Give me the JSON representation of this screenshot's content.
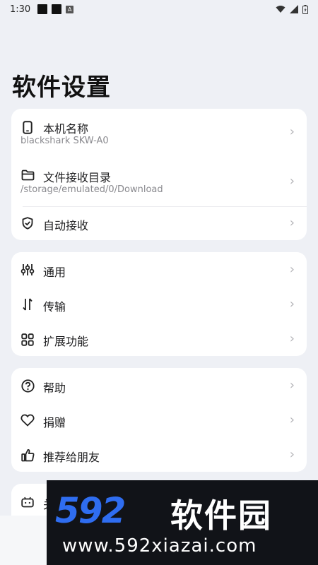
{
  "status": {
    "time": "1:30",
    "badge": "A"
  },
  "title": "软件设置",
  "card1": {
    "device": {
      "label": "本机名称",
      "value": "blackshark SKW-A0",
      "icon": "phone-icon"
    },
    "folder": {
      "label": "文件接收目录",
      "value": "/storage/emulated/0/Download",
      "icon": "folder-icon"
    },
    "auto": {
      "label": "自动接收",
      "icon": "shield-check-icon"
    }
  },
  "card2": {
    "general": {
      "label": "通用",
      "icon": "sliders-icon"
    },
    "transfer": {
      "label": "传输",
      "icon": "transfer-arrows-icon"
    },
    "extensions": {
      "label": "扩展功能",
      "icon": "grid-icon"
    }
  },
  "card3": {
    "help": {
      "label": "帮助",
      "icon": "help-circle-icon"
    },
    "donate": {
      "label": "捐赠",
      "icon": "heart-icon"
    },
    "share": {
      "label": "推荐给朋友",
      "icon": "thumbs-up-icon"
    }
  },
  "card4": {
    "partial_label": "关",
    "icon": "robot-icon"
  },
  "chevron": "›",
  "watermark": {
    "number": "592",
    "name": "软件园",
    "url": "www.592xiazai.com"
  },
  "colors": {
    "background": "#eef0f5",
    "card": "#ffffff",
    "watermark_blue": "#2f6df0"
  }
}
